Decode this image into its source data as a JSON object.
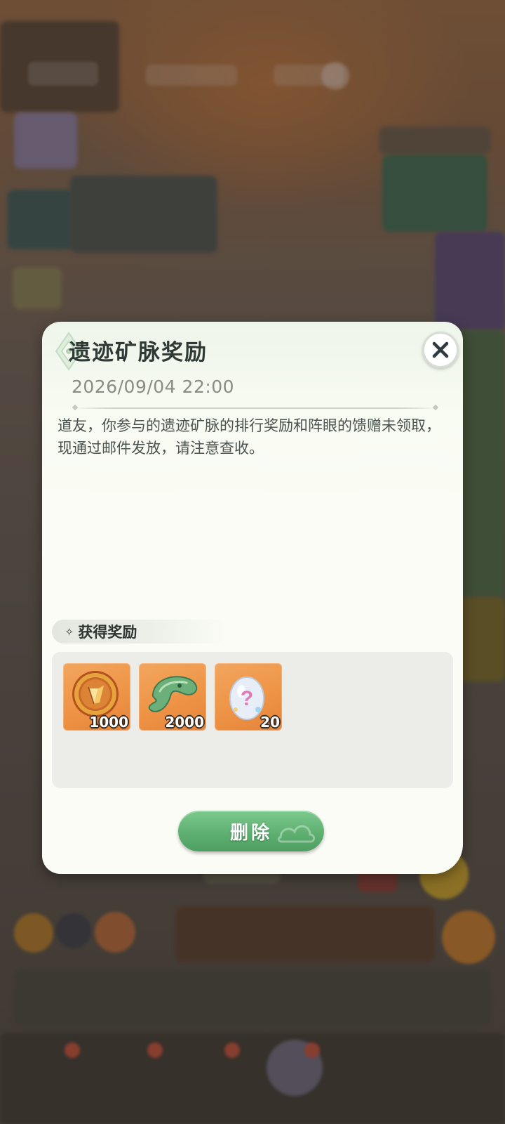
{
  "mail": {
    "title": "遗迹矿脉奖励",
    "date": "2026/09/04 22:00",
    "body": "道友，你参与的遗迹矿脉的排行奖励和阵眼的馈赠未领取，现通过邮件发放，请注意查收。"
  },
  "rewards": {
    "header": "获得奖励",
    "items": [
      {
        "icon": "gold-medal-icon",
        "qty": "1000"
      },
      {
        "icon": "jade-crest-icon",
        "qty": "2000"
      },
      {
        "icon": "mystery-egg-icon",
        "qty": "20"
      }
    ]
  },
  "actions": {
    "delete_label": "删除"
  },
  "colors": {
    "accent_green": "#5cae6f",
    "item_bg": "#ee9447",
    "title_text": "#2f3a36"
  }
}
